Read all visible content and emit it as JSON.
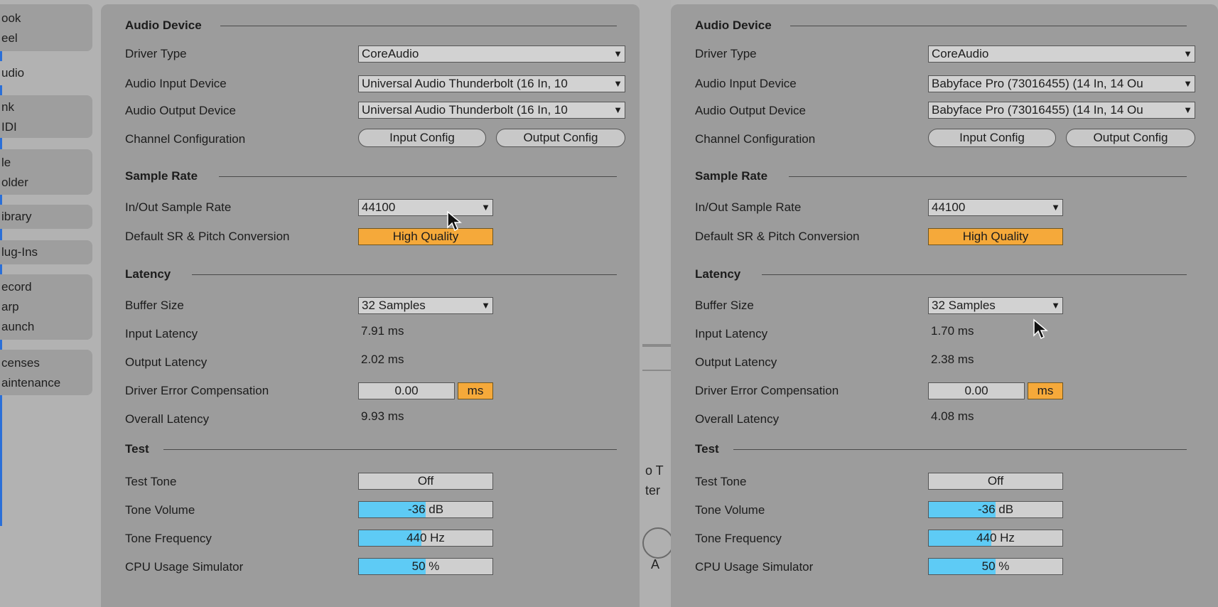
{
  "sidebar": {
    "tabs": [
      {
        "lines": [
          "ook",
          "eel"
        ]
      },
      {
        "lines": [
          "udio"
        ]
      },
      {
        "lines": [
          "nk",
          "IDI"
        ]
      },
      {
        "lines": [
          "le",
          "older"
        ]
      },
      {
        "lines": [
          "ibrary"
        ]
      },
      {
        "lines": [
          "lug-Ins"
        ]
      },
      {
        "lines": [
          "ecord",
          "arp",
          "aunch"
        ]
      },
      {
        "lines": [
          "censes",
          "aintenance"
        ]
      }
    ]
  },
  "gap": {
    "frag_text1": "o T",
    "frag_text2": "ter",
    "frag_text3": "A"
  },
  "panels": [
    {
      "audio_device": {
        "title": "Audio Device",
        "driver_type_label": "Driver Type",
        "driver_type": "CoreAudio",
        "input_device_label": "Audio Input Device",
        "input_device": "Universal Audio Thunderbolt (16 In, 10",
        "output_device_label": "Audio Output Device",
        "output_device": "Universal Audio Thunderbolt (16 In, 10",
        "channel_config_label": "Channel Configuration",
        "input_config": "Input Config",
        "output_config": "Output Config"
      },
      "sample_rate": {
        "title": "Sample Rate",
        "rate_label": "In/Out Sample Rate",
        "rate": "44100",
        "conversion_label": "Default SR & Pitch Conversion",
        "conversion": "High Quality"
      },
      "latency": {
        "title": "Latency",
        "buffer_label": "Buffer Size",
        "buffer": "32 Samples",
        "input_label": "Input Latency",
        "input": "7.91 ms",
        "output_label": "Output Latency",
        "output": "2.02 ms",
        "comp_label": "Driver Error Compensation",
        "comp": "0.00",
        "comp_unit": "ms",
        "overall_label": "Overall Latency",
        "overall": "9.93 ms"
      },
      "test": {
        "title": "Test",
        "tone_label": "Test Tone",
        "tone": "Off",
        "volume_label": "Tone Volume",
        "volume": "-36 dB",
        "volume_level": 0.5,
        "freq_label": "Tone Frequency",
        "freq": "440 Hz",
        "freq_level": 0.47,
        "cpu_label": "CPU Usage Simulator",
        "cpu": "50 %",
        "cpu_level": 0.5
      }
    },
    {
      "audio_device": {
        "title": "Audio Device",
        "driver_type_label": "Driver Type",
        "driver_type": "CoreAudio",
        "input_device_label": "Audio Input Device",
        "input_device": "Babyface Pro (73016455) (14 In, 14 Ou",
        "output_device_label": "Audio Output Device",
        "output_device": "Babyface Pro (73016455) (14 In, 14 Ou",
        "channel_config_label": "Channel Configuration",
        "input_config": "Input Config",
        "output_config": "Output Config"
      },
      "sample_rate": {
        "title": "Sample Rate",
        "rate_label": "In/Out Sample Rate",
        "rate": "44100",
        "conversion_label": "Default SR & Pitch Conversion",
        "conversion": "High Quality"
      },
      "latency": {
        "title": "Latency",
        "buffer_label": "Buffer Size",
        "buffer": "32 Samples",
        "input_label": "Input Latency",
        "input": "1.70 ms",
        "output_label": "Output Latency",
        "output": "2.38 ms",
        "comp_label": "Driver Error Compensation",
        "comp": "0.00",
        "comp_unit": "ms",
        "overall_label": "Overall Latency",
        "overall": "4.08 ms"
      },
      "test": {
        "title": "Test",
        "tone_label": "Test Tone",
        "tone": "Off",
        "volume_label": "Tone Volume",
        "volume": "-36 dB",
        "volume_level": 0.5,
        "freq_label": "Tone Frequency",
        "freq": "440 Hz",
        "freq_level": 0.47,
        "cpu_label": "CPU Usage Simulator",
        "cpu": "50 %",
        "cpu_level": 0.5
      }
    }
  ],
  "colors": {
    "accent_orange": "#f5a93a",
    "slider_blue": "#5ecbf5",
    "panel_bg": "#9c9c9c"
  },
  "icons": {
    "dropdown": "triangle-down",
    "cursor": "mouse-pointer"
  }
}
